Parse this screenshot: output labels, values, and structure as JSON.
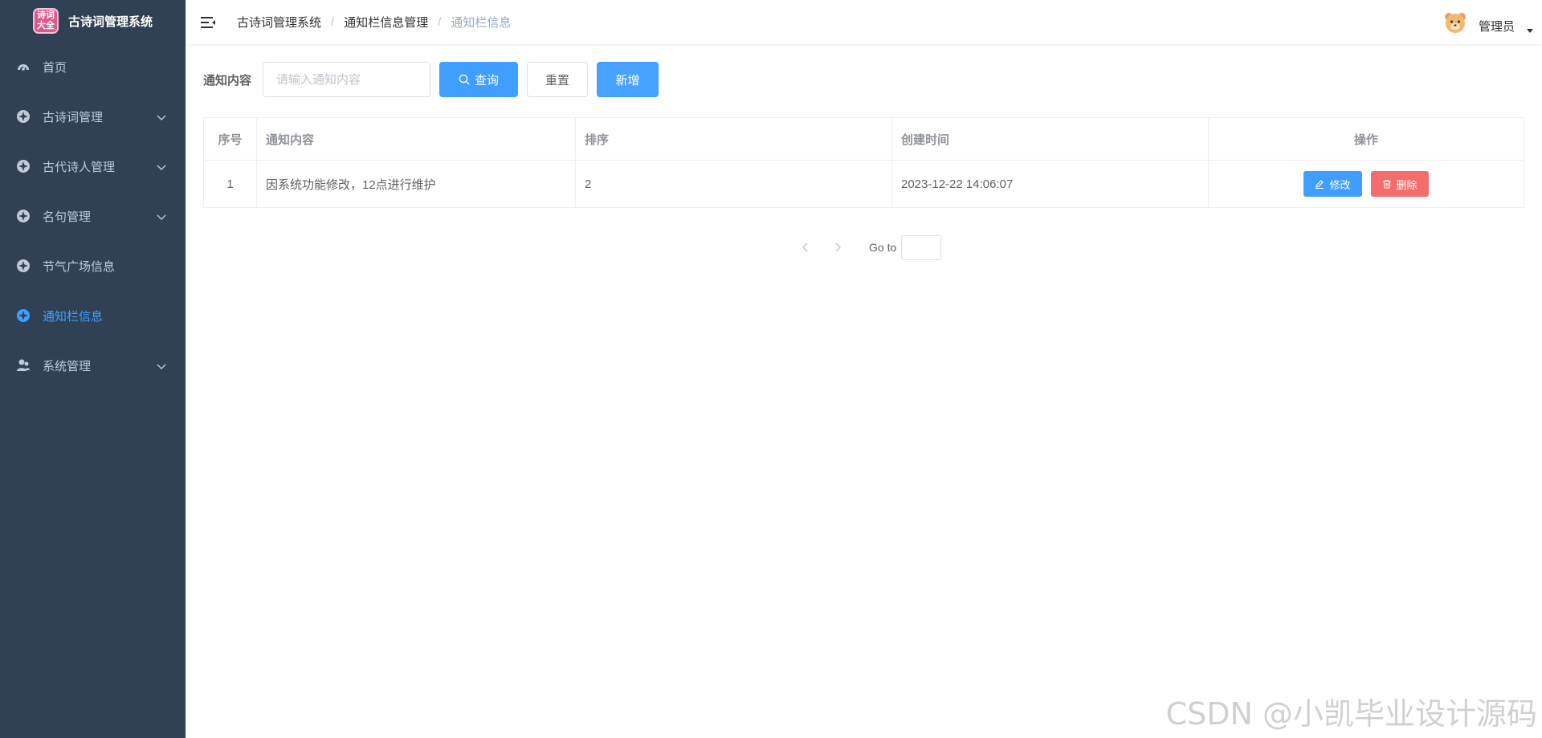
{
  "app": {
    "logo_line1": "诗词",
    "logo_line2": "大全",
    "title": "古诗词管理系统"
  },
  "sidebar": {
    "items": [
      {
        "label": "首页",
        "icon": "dashboard-icon",
        "has_submenu": false,
        "active": false
      },
      {
        "label": "古诗词管理",
        "icon": "compass-icon",
        "has_submenu": true,
        "active": false
      },
      {
        "label": "古代诗人管理",
        "icon": "compass-icon",
        "has_submenu": true,
        "active": false
      },
      {
        "label": "名句管理",
        "icon": "compass-icon",
        "has_submenu": true,
        "active": false
      },
      {
        "label": "节气广场信息",
        "icon": "compass-icon",
        "has_submenu": false,
        "active": false
      },
      {
        "label": "通知栏信息",
        "icon": "compass-icon",
        "has_submenu": false,
        "active": true
      },
      {
        "label": "系统管理",
        "icon": "user-icon",
        "has_submenu": true,
        "active": false
      }
    ]
  },
  "header": {
    "breadcrumb": [
      "古诗词管理系统",
      "通知栏信息管理",
      "通知栏信息"
    ],
    "separator": "/",
    "user_name": "管理员"
  },
  "search": {
    "label": "通知内容",
    "placeholder": "请输入通知内容",
    "value": "",
    "query_label": "查询",
    "reset_label": "重置",
    "add_label": "新增"
  },
  "table": {
    "columns": [
      "序号",
      "通知内容",
      "排序",
      "创建时间",
      "操作"
    ],
    "rows": [
      {
        "index": "1",
        "content": "因系统功能修改，12点进行维护",
        "sort": "2",
        "created": "2023-12-22 14:06:07"
      }
    ],
    "edit_label": "修改",
    "delete_label": "删除"
  },
  "pagination": {
    "goto_label": "Go to",
    "goto_value": ""
  },
  "watermark": "CSDN @小凯毕业设计源码",
  "colors": {
    "sidebar_bg": "#304156",
    "sidebar_text": "#bfcbd9",
    "active": "#409eff",
    "danger": "#f56c6c"
  }
}
